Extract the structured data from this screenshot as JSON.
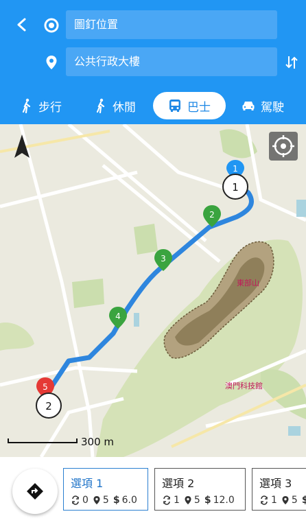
{
  "header": {
    "from_value": "圖釘位置",
    "to_value": "公共行政大樓"
  },
  "modes": [
    {
      "label": "步行"
    },
    {
      "label": "休閒"
    },
    {
      "label": "巴士"
    },
    {
      "label": "駕駛"
    }
  ],
  "map": {
    "scale_label": "300 m",
    "stop_start": "1",
    "stop_end": "2",
    "route_markers": [
      "1",
      "2",
      "3",
      "4",
      "5"
    ],
    "place_labels": [
      "東部山",
      "澳門科技館"
    ],
    "route_color": "#2e86de"
  },
  "options": [
    {
      "label": "選項 1",
      "transfers": "0",
      "stops": "5",
      "price": "6.0"
    },
    {
      "label": "選項 2",
      "transfers": "1",
      "stops": "5",
      "price": "12.0"
    },
    {
      "label": "選項 3",
      "transfers": "1",
      "stops": "5",
      "price": ""
    }
  ]
}
